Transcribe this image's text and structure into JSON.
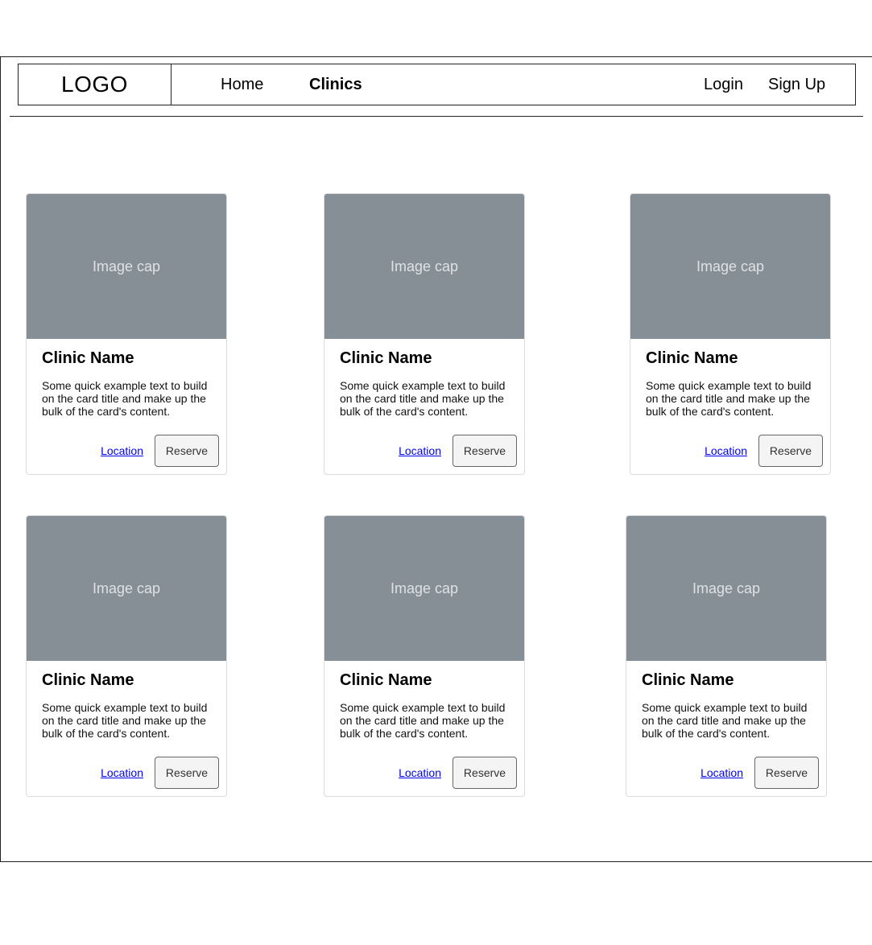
{
  "header": {
    "logo": "LOGO",
    "nav": [
      {
        "label": "Home",
        "active": false
      },
      {
        "label": "Clinics",
        "active": true
      }
    ],
    "auth": [
      {
        "label": "Login"
      },
      {
        "label": "Sign Up"
      }
    ]
  },
  "cards": [
    {
      "image_label": "Image cap",
      "title": "Clinic Name",
      "text": "Some quick example text to build on the card title and make up the bulk of the card's content.",
      "location_label": "Location",
      "reserve_label": "Reserve"
    },
    {
      "image_label": "Image cap",
      "title": "Clinic Name",
      "text": "Some quick example text to build on the card title and make up the bulk of the card's content.",
      "location_label": "Location",
      "reserve_label": "Reserve"
    },
    {
      "image_label": "Image cap",
      "title": "Clinic Name",
      "text": "Some quick example text to build on the card title and make up the bulk of the card's content.",
      "location_label": "Location",
      "reserve_label": "Reserve"
    },
    {
      "image_label": "Image cap",
      "title": "Clinic Name",
      "text": "Some quick example text to build on the card title and make up the bulk of the card's content.",
      "location_label": "Location",
      "reserve_label": "Reserve"
    },
    {
      "image_label": "Image cap",
      "title": "Clinic Name",
      "text": "Some quick example text to build on the card title and make up the bulk of the card's content.",
      "location_label": "Location",
      "reserve_label": "Reserve"
    },
    {
      "image_label": "Image cap",
      "title": "Clinic Name",
      "text": "Some quick example text to build on the card title and make up the bulk of the card's content.",
      "location_label": "Location",
      "reserve_label": "Reserve"
    }
  ],
  "colors": {
    "image_placeholder_bg": "#868e96",
    "image_placeholder_text": "#dee2e6",
    "link": "#0000ee"
  }
}
